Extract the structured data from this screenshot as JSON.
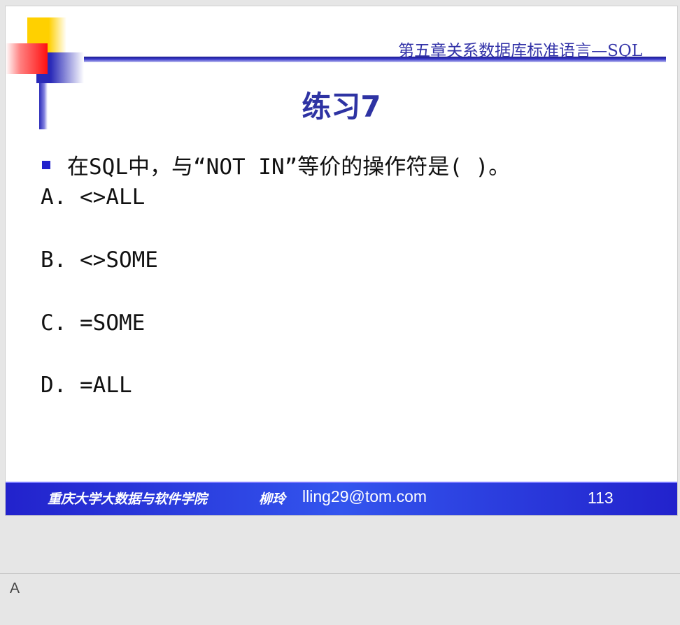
{
  "slide": {
    "header_title": "第五章关系数据库标准语言—SQL",
    "title": "练习7",
    "question": "在SQL中，与“NOT IN”等价的操作符是( )。",
    "options": [
      "A. <>ALL",
      "B. <>SOME",
      "C. =SOME",
      "D. =ALL"
    ],
    "footer": {
      "institution": "重庆大学大数据与软件学院",
      "author": "柳玲",
      "email": "lling29@tom.com",
      "page_number": "113"
    },
    "colors": {
      "accent": "#2e33a3",
      "footer_bar": "#2233dd",
      "deco_yellow": "#ffd000",
      "deco_red": "#ff1010"
    }
  },
  "notes": {
    "text": "A"
  }
}
